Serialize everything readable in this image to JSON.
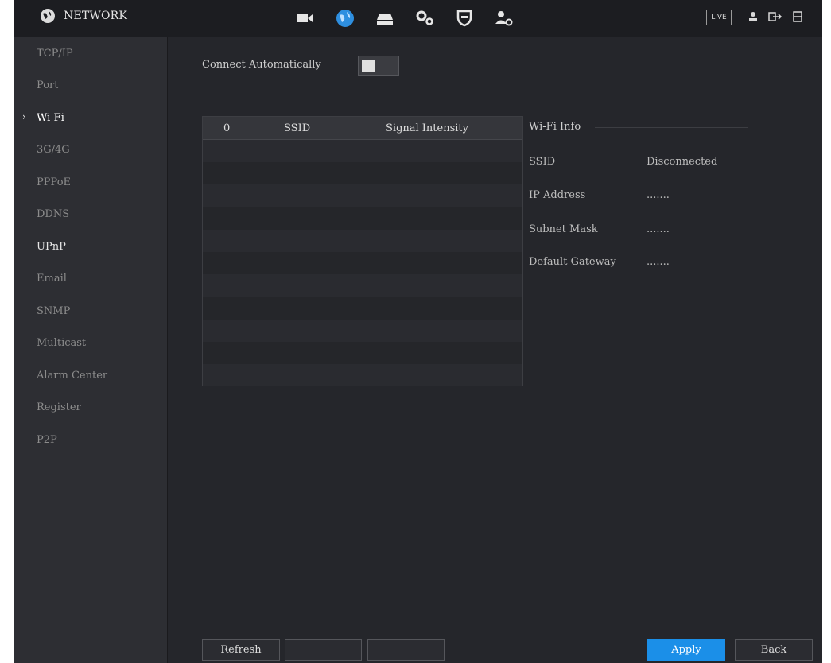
{
  "header": {
    "title": "NETWORK",
    "icons": [
      "camera-icon",
      "network-globe-icon",
      "storage-icon",
      "system-gears-icon",
      "security-shield-icon",
      "account-icon"
    ],
    "live_label": "LIVE",
    "utility_icons": [
      "user-icon",
      "logout-icon",
      "menu-grid-icon"
    ]
  },
  "sidebar": {
    "items": [
      {
        "label": "TCP/IP"
      },
      {
        "label": "Port"
      },
      {
        "label": "Wi-Fi"
      },
      {
        "label": "3G/4G"
      },
      {
        "label": "PPPoE"
      },
      {
        "label": "DDNS"
      },
      {
        "label": "UPnP"
      },
      {
        "label": "Email"
      },
      {
        "label": "SNMP"
      },
      {
        "label": "Multicast"
      },
      {
        "label": "Alarm Center"
      },
      {
        "label": "Register"
      },
      {
        "label": "P2P"
      }
    ],
    "selected": "Wi-Fi"
  },
  "main": {
    "connect_label": "Connect Automatically",
    "connect_enabled": false,
    "table": {
      "columns": [
        "0",
        "SSID",
        "Signal Intensity"
      ],
      "rows": []
    },
    "info": {
      "title": "Wi-Fi Info",
      "fields": [
        {
          "key": "SSID",
          "value": "Disconnected"
        },
        {
          "key": "IP Address",
          "value": "......."
        },
        {
          "key": "Subnet Mask",
          "value": "......."
        },
        {
          "key": "Default Gateway",
          "value": "......."
        }
      ]
    }
  },
  "footer": {
    "refresh": "Refresh",
    "blank1": "",
    "blank2": "",
    "apply": "Apply",
    "back": "Back"
  },
  "colors": {
    "accent": "#1b8fe8",
    "background": "#25262b",
    "sidebar": "#2d2e33"
  }
}
